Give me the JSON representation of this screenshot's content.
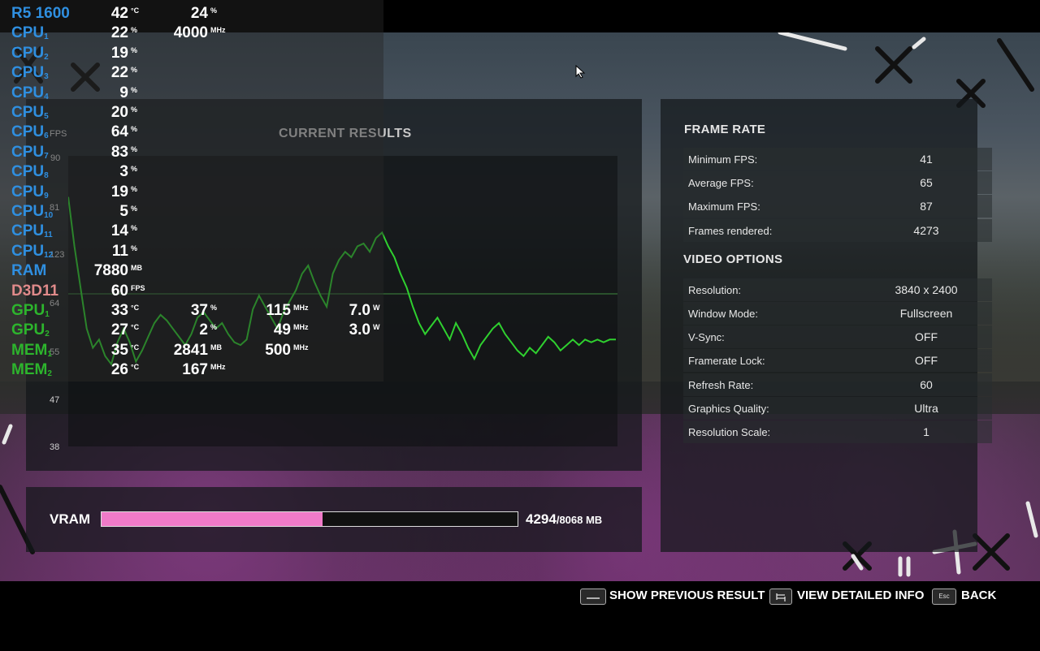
{
  "results": {
    "title": "CURRENT RESULTS"
  },
  "graph": {
    "y_labels": [
      "FPS",
      "90",
      "81",
      "123",
      "64",
      "55",
      "47",
      "38"
    ],
    "points": [
      [
        0,
        88
      ],
      [
        2,
        70
      ],
      [
        4,
        55
      ],
      [
        6,
        40
      ],
      [
        8,
        33
      ],
      [
        10,
        36
      ],
      [
        12,
        30
      ],
      [
        14,
        27
      ],
      [
        16,
        35
      ],
      [
        18,
        40
      ],
      [
        20,
        35
      ],
      [
        22,
        28
      ],
      [
        24,
        32
      ],
      [
        26,
        37
      ],
      [
        28,
        42
      ],
      [
        30,
        45
      ],
      [
        32,
        43
      ],
      [
        34,
        40
      ],
      [
        36,
        37
      ],
      [
        38,
        34
      ],
      [
        40,
        38
      ],
      [
        42,
        44
      ],
      [
        44,
        46
      ],
      [
        46,
        43
      ],
      [
        48,
        40
      ],
      [
        50,
        42
      ],
      [
        52,
        38
      ],
      [
        54,
        35
      ],
      [
        56,
        34
      ],
      [
        58,
        36
      ],
      [
        60,
        47
      ],
      [
        62,
        52
      ],
      [
        64,
        48
      ],
      [
        66,
        44
      ],
      [
        68,
        40
      ],
      [
        70,
        46
      ],
      [
        72,
        50
      ],
      [
        74,
        54
      ],
      [
        76,
        60
      ],
      [
        78,
        63
      ],
      [
        80,
        57
      ],
      [
        82,
        52
      ],
      [
        84,
        48
      ],
      [
        86,
        60
      ],
      [
        88,
        65
      ],
      [
        90,
        68
      ],
      [
        92,
        66
      ],
      [
        94,
        70
      ],
      [
        96,
        71
      ],
      [
        98,
        68
      ],
      [
        100,
        73
      ],
      [
        102,
        75
      ],
      [
        104,
        70
      ],
      [
        106,
        66
      ],
      [
        108,
        60
      ],
      [
        110,
        55
      ],
      [
        112,
        48
      ],
      [
        114,
        42
      ],
      [
        116,
        38
      ],
      [
        118,
        41
      ],
      [
        120,
        44
      ],
      [
        122,
        40
      ],
      [
        124,
        36
      ],
      [
        126,
        42
      ],
      [
        128,
        38
      ],
      [
        130,
        33
      ],
      [
        132,
        29
      ],
      [
        134,
        34
      ],
      [
        136,
        37
      ],
      [
        138,
        40
      ],
      [
        140,
        42
      ],
      [
        142,
        38
      ],
      [
        144,
        35
      ],
      [
        146,
        32
      ],
      [
        148,
        30
      ],
      [
        150,
        33
      ],
      [
        152,
        31
      ],
      [
        154,
        34
      ],
      [
        156,
        37
      ],
      [
        158,
        35
      ],
      [
        160,
        32
      ],
      [
        162,
        34
      ],
      [
        164,
        36
      ],
      [
        166,
        34
      ],
      [
        168,
        36
      ],
      [
        170,
        35
      ],
      [
        172,
        36
      ],
      [
        174,
        35
      ],
      [
        176,
        36
      ],
      [
        178,
        36
      ]
    ]
  },
  "osd": [
    {
      "name": "R5 1600",
      "sub": "",
      "color": "blue",
      "vals": [
        {
          "v": "42",
          "u": "°C"
        },
        {
          "v": "24",
          "u": "%"
        }
      ]
    },
    {
      "name": "CPU",
      "sub": "1",
      "color": "blue",
      "vals": [
        {
          "v": "22",
          "u": "%"
        },
        {
          "v": "4000",
          "u": "MHz"
        }
      ]
    },
    {
      "name": "CPU",
      "sub": "2",
      "color": "blue",
      "vals": [
        {
          "v": "19",
          "u": "%"
        }
      ]
    },
    {
      "name": "CPU",
      "sub": "3",
      "color": "blue",
      "vals": [
        {
          "v": "22",
          "u": "%"
        }
      ]
    },
    {
      "name": "CPU",
      "sub": "4",
      "color": "blue",
      "vals": [
        {
          "v": "9",
          "u": "%"
        }
      ]
    },
    {
      "name": "CPU",
      "sub": "5",
      "color": "blue",
      "vals": [
        {
          "v": "20",
          "u": "%"
        }
      ]
    },
    {
      "name": "CPU",
      "sub": "6",
      "color": "blue",
      "vals": [
        {
          "v": "64",
          "u": "%"
        }
      ]
    },
    {
      "name": "CPU",
      "sub": "7",
      "color": "blue",
      "vals": [
        {
          "v": "83",
          "u": "%"
        }
      ]
    },
    {
      "name": "CPU",
      "sub": "8",
      "color": "blue",
      "vals": [
        {
          "v": "3",
          "u": "%"
        }
      ]
    },
    {
      "name": "CPU",
      "sub": "9",
      "color": "blue",
      "vals": [
        {
          "v": "19",
          "u": "%"
        }
      ]
    },
    {
      "name": "CPU",
      "sub": "10",
      "color": "blue",
      "vals": [
        {
          "v": "5",
          "u": "%"
        }
      ]
    },
    {
      "name": "CPU",
      "sub": "11",
      "color": "blue",
      "vals": [
        {
          "v": "14",
          "u": "%"
        }
      ]
    },
    {
      "name": "CPU",
      "sub": "12",
      "color": "blue",
      "vals": [
        {
          "v": "11",
          "u": "%"
        }
      ]
    },
    {
      "name": "RAM",
      "sub": "",
      "color": "blue",
      "vals": [
        {
          "v": "7880",
          "u": "MB"
        }
      ]
    },
    {
      "name": "D3D11",
      "sub": "",
      "color": "pink",
      "vals": [
        {
          "v": "60",
          "u": "FPS"
        }
      ]
    },
    {
      "name": "GPU",
      "sub": "1",
      "color": "green",
      "vals": [
        {
          "v": "33",
          "u": "°C"
        },
        {
          "v": "37",
          "u": "%"
        },
        {
          "v": "115",
          "u": "MHz"
        },
        {
          "v": "7.0",
          "u": "W"
        }
      ]
    },
    {
      "name": "GPU",
      "sub": "2",
      "color": "green",
      "vals": [
        {
          "v": "27",
          "u": "°C"
        },
        {
          "v": "2",
          "u": "%"
        },
        {
          "v": "49",
          "u": "MHz"
        },
        {
          "v": "3.0",
          "u": "W"
        }
      ]
    },
    {
      "name": "MEM",
      "sub": "1",
      "color": "green",
      "vals": [
        {
          "v": "35",
          "u": "°C"
        },
        {
          "v": "2841",
          "u": "MB"
        },
        {
          "v": "500",
          "u": "MHz"
        }
      ]
    },
    {
      "name": "MEM",
      "sub": "2",
      "color": "green",
      "vals": [
        {
          "v": "26",
          "u": "°C"
        },
        {
          "v": "167",
          "u": "MHz"
        }
      ]
    }
  ],
  "frame_rate": {
    "title": "FRAME RATE",
    "rows": [
      {
        "k": "Minimum FPS:",
        "v": "41"
      },
      {
        "k": "Average FPS:",
        "v": "65"
      },
      {
        "k": "Maximum FPS:",
        "v": "87"
      },
      {
        "k": "Frames rendered:",
        "v": "4273"
      }
    ]
  },
  "video_options": {
    "title": "VIDEO OPTIONS",
    "rows": [
      {
        "k": "Resolution:",
        "v": "3840 x 2400"
      },
      {
        "k": "Window Mode:",
        "v": "Fullscreen"
      },
      {
        "k": "V-Sync:",
        "v": "OFF"
      },
      {
        "k": "Framerate Lock:",
        "v": "OFF"
      },
      {
        "k": "Refresh Rate:",
        "v": "60"
      },
      {
        "k": "Graphics Quality:",
        "v": "Ultra"
      },
      {
        "k": "Resolution Scale:",
        "v": "1"
      }
    ]
  },
  "vram": {
    "label": "VRAM",
    "used": "4294",
    "total": "/8068 MB",
    "fill_fraction": 0.532
  },
  "hints": {
    "prev": "SHOW PREVIOUS RESULT",
    "detail": "VIEW DETAILED INFO",
    "back": "BACK",
    "esc_key": "Esc"
  },
  "colors": {
    "line": "#2fd02f",
    "vram": "#f07ac8",
    "blue": "#2f8fe0",
    "green": "#2db52d",
    "pink": "#e08a8a"
  }
}
